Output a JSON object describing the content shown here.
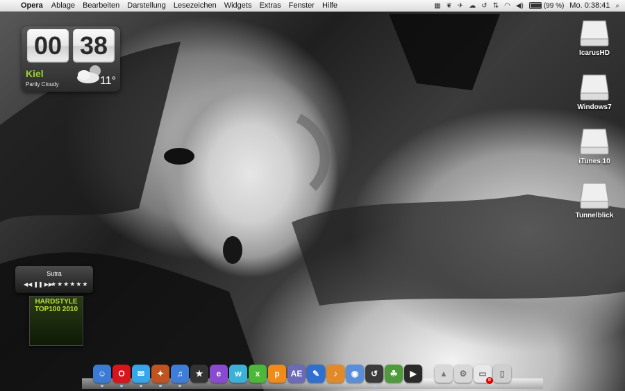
{
  "menubar": {
    "app_name": "Opera",
    "menus": [
      "Ablage",
      "Bearbeiten",
      "Darstellung",
      "Lesezeichen",
      "Widgets",
      "Extras",
      "Fenster",
      "Hilfe"
    ],
    "battery_text": "(99 %)",
    "battery_level": 0.99,
    "clock": "Mo. 0:38:41"
  },
  "clock_widget": {
    "hours": "00",
    "minutes": "38",
    "city": "Kiel",
    "condition": "Partly Cloudy",
    "temperature": "11°"
  },
  "desktop_drives": [
    {
      "label": "IcarusHD"
    },
    {
      "label": "Windows7"
    },
    {
      "label": "iTunes 10"
    },
    {
      "label": "Tunnelblick"
    }
  ],
  "music_widget": {
    "track": "Sutra",
    "controls": [
      "◀◀",
      "❚❚",
      "▶▶"
    ],
    "stars": "★★★★★★",
    "album_title": "HARDSTYLE TOP100 2010"
  },
  "dock": {
    "apps": [
      {
        "name": "finder",
        "color": "#3a7bd5",
        "glyph": "☺"
      },
      {
        "name": "opera",
        "color": "#d8141c",
        "glyph": "O"
      },
      {
        "name": "messages",
        "color": "#36a6e8",
        "glyph": "✉"
      },
      {
        "name": "photo-app",
        "color": "#c0531f",
        "glyph": "✦"
      },
      {
        "name": "itunes",
        "color": "#3f7ed8",
        "glyph": "♫"
      },
      {
        "name": "movie-app",
        "color": "#333333",
        "glyph": "★"
      },
      {
        "name": "app-e",
        "color": "#8a4ad0",
        "glyph": "e"
      },
      {
        "name": "app-w",
        "color": "#3bb0d8",
        "glyph": "w"
      },
      {
        "name": "app-x",
        "color": "#4cb83a",
        "glyph": "x"
      },
      {
        "name": "app-p",
        "color": "#f08a1a",
        "glyph": "p"
      },
      {
        "name": "after-effects",
        "color": "#6b6bb8",
        "glyph": "AE"
      },
      {
        "name": "pen-app",
        "color": "#2f6fd0",
        "glyph": "✎"
      },
      {
        "name": "audio-app",
        "color": "#e08a2a",
        "glyph": "♪"
      },
      {
        "name": "preview-app",
        "color": "#5b8ed8",
        "glyph": "◉"
      },
      {
        "name": "time-machine",
        "color": "#3a3a3a",
        "glyph": "↺"
      },
      {
        "name": "game-app",
        "color": "#4f9a3a",
        "glyph": "☘"
      },
      {
        "name": "quicktime",
        "color": "#2a2a2a",
        "glyph": "▶"
      }
    ],
    "stacks": [
      {
        "name": "applications-stack",
        "color": "#d8d8d8",
        "glyph": "▲"
      },
      {
        "name": "system-prefs",
        "color": "#d8d8d8",
        "glyph": "⚙"
      },
      {
        "name": "mail-stack",
        "color": "#e8e8e8",
        "glyph": "▭",
        "badge": "0"
      },
      {
        "name": "trash",
        "color": "#cfcfcf",
        "glyph": "▯"
      }
    ]
  }
}
